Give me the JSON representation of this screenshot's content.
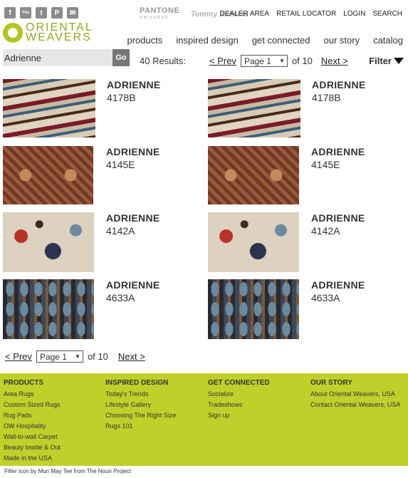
{
  "social": {
    "facebook": "f",
    "youtube": "You",
    "twitter": "t",
    "pinterest": "P",
    "email": "✉"
  },
  "partners": {
    "pantone": "PANTONE",
    "pantone_sub": "UNIVERSE",
    "tommy": "Tommy Bahama"
  },
  "toplinks": [
    "DEALER AREA",
    "RETAIL LOCATOR",
    "LOGIN",
    "SEARCH"
  ],
  "brand": {
    "line1": "ORIENTAL",
    "line2": "WEAVERS",
    "accent": "#b5c41d"
  },
  "mainnav": [
    "products",
    "inspired design",
    "get connected",
    "our story",
    "catalog"
  ],
  "search": {
    "value": "Adrienne",
    "button": "Go"
  },
  "results_text": "40 Results:",
  "pager": {
    "prev": "< Prev",
    "page": "Page 1",
    "of": "of 10",
    "next": "Next >"
  },
  "filter_label": "Filter",
  "products": [
    {
      "name": "ADRIENNE",
      "code": "4178B",
      "pattern": "waves"
    },
    {
      "name": "ADRIENNE",
      "code": "4178B",
      "pattern": "waves"
    },
    {
      "name": "ADRIENNE",
      "code": "4145E",
      "pattern": "medallion"
    },
    {
      "name": "ADRIENNE",
      "code": "4145E",
      "pattern": "medallion"
    },
    {
      "name": "ADRIENNE",
      "code": "4142A",
      "pattern": "floral"
    },
    {
      "name": "ADRIENNE",
      "code": "4142A",
      "pattern": "floral"
    },
    {
      "name": "ADRIENNE",
      "code": "4633A",
      "pattern": "ikat"
    },
    {
      "name": "ADRIENNE",
      "code": "4633A",
      "pattern": "ikat"
    }
  ],
  "footer": {
    "bg": "#bfd02a",
    "columns": [
      {
        "title": "PRODUCTS",
        "items": [
          "Area Rugs",
          "Custom Sized Rugs",
          "Rug Pads",
          "OW Hospitality",
          "Wall-to-wall Carpet",
          "Beauty Inside & Out",
          "Made in the USA"
        ]
      },
      {
        "title": "INSPIRED DESIGN",
        "items": [
          "Today's Trends",
          "Lifestyle Gallery",
          "Choosing The Right Size",
          "Rugs 101"
        ]
      },
      {
        "title": "GET CONNECTED",
        "items": [
          "Socialize",
          "Tradeshows",
          "Sign up"
        ]
      },
      {
        "title": "OUR STORY",
        "items": [
          "About Oriental Weavers, USA",
          "Contact Oriental Weavers, USA"
        ]
      }
    ]
  },
  "credit": "Filter icon by Mun May Tee from The Noun Project"
}
